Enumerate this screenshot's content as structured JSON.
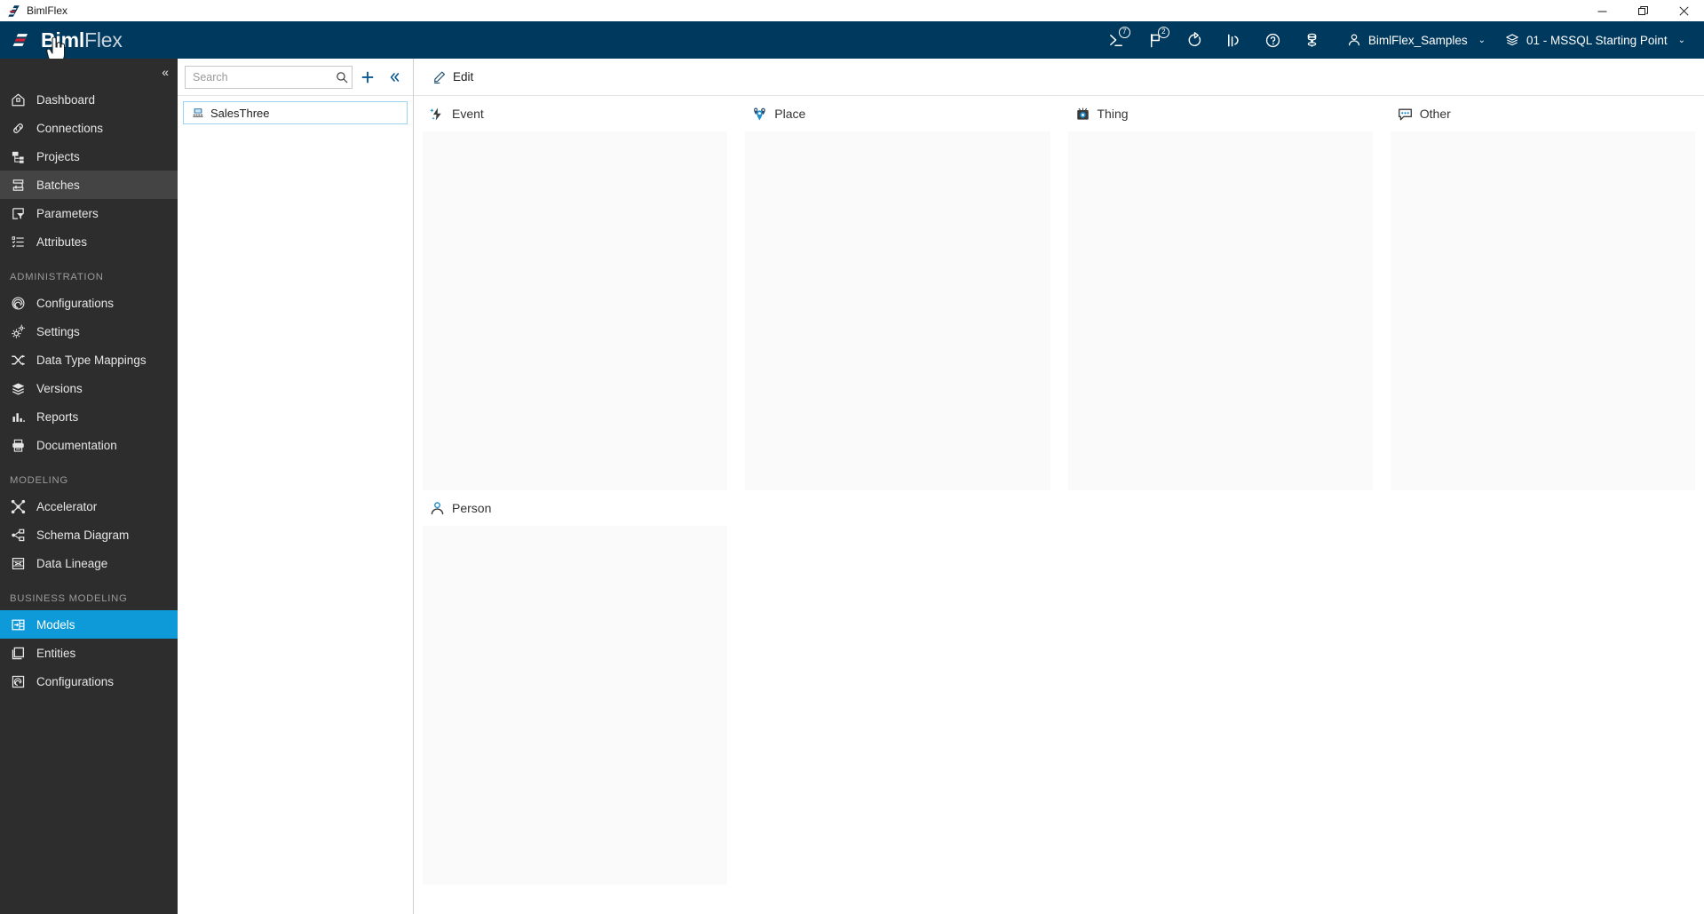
{
  "window": {
    "title": "BimlFlex",
    "buttons": {
      "minimize": "─",
      "restore": "❐",
      "close": "✕"
    }
  },
  "header": {
    "brand_bold": "Biml",
    "brand_light": "Flex",
    "icons": [
      {
        "name": "console-icon",
        "badge": "7"
      },
      {
        "name": "flag-icon",
        "badge": "2"
      },
      {
        "name": "refresh-icon",
        "badge": ""
      },
      {
        "name": "metrics-icon",
        "badge": ""
      },
      {
        "name": "help-icon",
        "badge": ""
      },
      {
        "name": "database-icon",
        "badge": ""
      }
    ],
    "user_menu": {
      "label": "BimlFlex_Samples",
      "caret": "⌄"
    },
    "project_menu": {
      "label": "01 - MSSQL Starting Point",
      "caret": "⌄"
    }
  },
  "sidebar": {
    "collapse_glyph": "«",
    "items": [
      {
        "label": "Dashboard",
        "icon": "home-icon",
        "state": ""
      },
      {
        "label": "Connections",
        "icon": "link-icon",
        "state": ""
      },
      {
        "label": "Projects",
        "icon": "projects-icon",
        "state": ""
      },
      {
        "label": "Batches",
        "icon": "batches-icon",
        "state": "active-grey"
      },
      {
        "label": "Parameters",
        "icon": "parameters-icon",
        "state": ""
      },
      {
        "label": "Attributes",
        "icon": "attributes-icon",
        "state": ""
      }
    ],
    "groups": [
      {
        "title": "ADMINISTRATION",
        "items": [
          {
            "label": "Configurations",
            "icon": "configurations-icon",
            "state": ""
          },
          {
            "label": "Settings",
            "icon": "settings-icon",
            "state": ""
          },
          {
            "label": "Data Type Mappings",
            "icon": "shuffle-icon",
            "state": ""
          },
          {
            "label": "Versions",
            "icon": "layers-icon",
            "state": ""
          },
          {
            "label": "Reports",
            "icon": "reports-icon",
            "state": ""
          },
          {
            "label": "Documentation",
            "icon": "documentation-icon",
            "state": ""
          }
        ]
      },
      {
        "title": "MODELING",
        "items": [
          {
            "label": "Accelerator",
            "icon": "accelerator-icon",
            "state": ""
          },
          {
            "label": "Schema Diagram",
            "icon": "schema-diagram-icon",
            "state": ""
          },
          {
            "label": "Data Lineage",
            "icon": "data-lineage-icon",
            "state": ""
          }
        ]
      },
      {
        "title": "BUSINESS MODELING",
        "items": [
          {
            "label": "Models",
            "icon": "models-icon",
            "state": "active-blue"
          },
          {
            "label": "Entities",
            "icon": "entities-icon",
            "state": ""
          },
          {
            "label": "Configurations",
            "icon": "business-configurations-icon",
            "state": ""
          }
        ]
      }
    ]
  },
  "tree": {
    "search": {
      "placeholder": "Search",
      "value": ""
    },
    "add_label": "+",
    "collapse_glyph": "«",
    "items": [
      {
        "label": "SalesThree",
        "icon": "model-icon",
        "selected": true
      }
    ]
  },
  "main": {
    "toolbar": {
      "edit_label": "Edit",
      "edit_icon": "pencil-icon"
    },
    "lanes_row1": [
      {
        "label": "Event",
        "icon": "event-icon"
      },
      {
        "label": "Place",
        "icon": "place-icon"
      },
      {
        "label": "Thing",
        "icon": "thing-icon"
      },
      {
        "label": "Other",
        "icon": "other-icon"
      }
    ],
    "lanes_row2": [
      {
        "label": "Person",
        "icon": "person-icon"
      }
    ]
  },
  "colors": {
    "header_navy": "#00395e",
    "sidebar_dark": "#2d2d2d",
    "accent_blue": "#0e9ad8",
    "link_blue": "#0c5b95",
    "dropzone": "#fafafa",
    "brand_red": "#c8102e"
  }
}
